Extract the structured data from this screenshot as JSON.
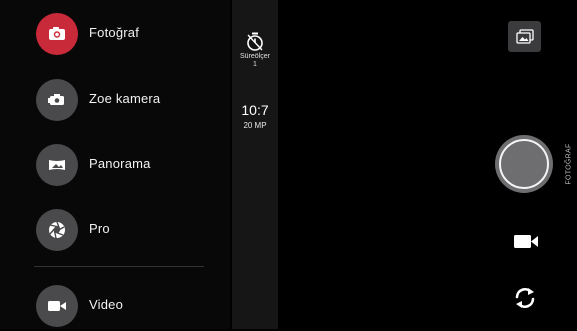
{
  "modes": [
    {
      "label": "Fotoğraf",
      "icon": "camera-icon",
      "active": true
    },
    {
      "label": "Zoe kamera",
      "icon": "zoe-camera-icon",
      "active": false
    },
    {
      "label": "Panorama",
      "icon": "panorama-icon",
      "active": false
    },
    {
      "label": "Pro",
      "icon": "aperture-icon",
      "active": false
    },
    {
      "label": "Video",
      "icon": "video-camera-icon",
      "active": false
    }
  ],
  "settings": {
    "timer_label": "Süreölçer",
    "timer_value": "1",
    "resolution_ratio": "10:7",
    "resolution_mp": "20 MP"
  },
  "controls": {
    "current_mode_label": "FOTOĞRAF"
  },
  "colors": {
    "active_mode": "#c92a3a",
    "inactive_mode": "#4a4a4c",
    "background": "#000000"
  }
}
